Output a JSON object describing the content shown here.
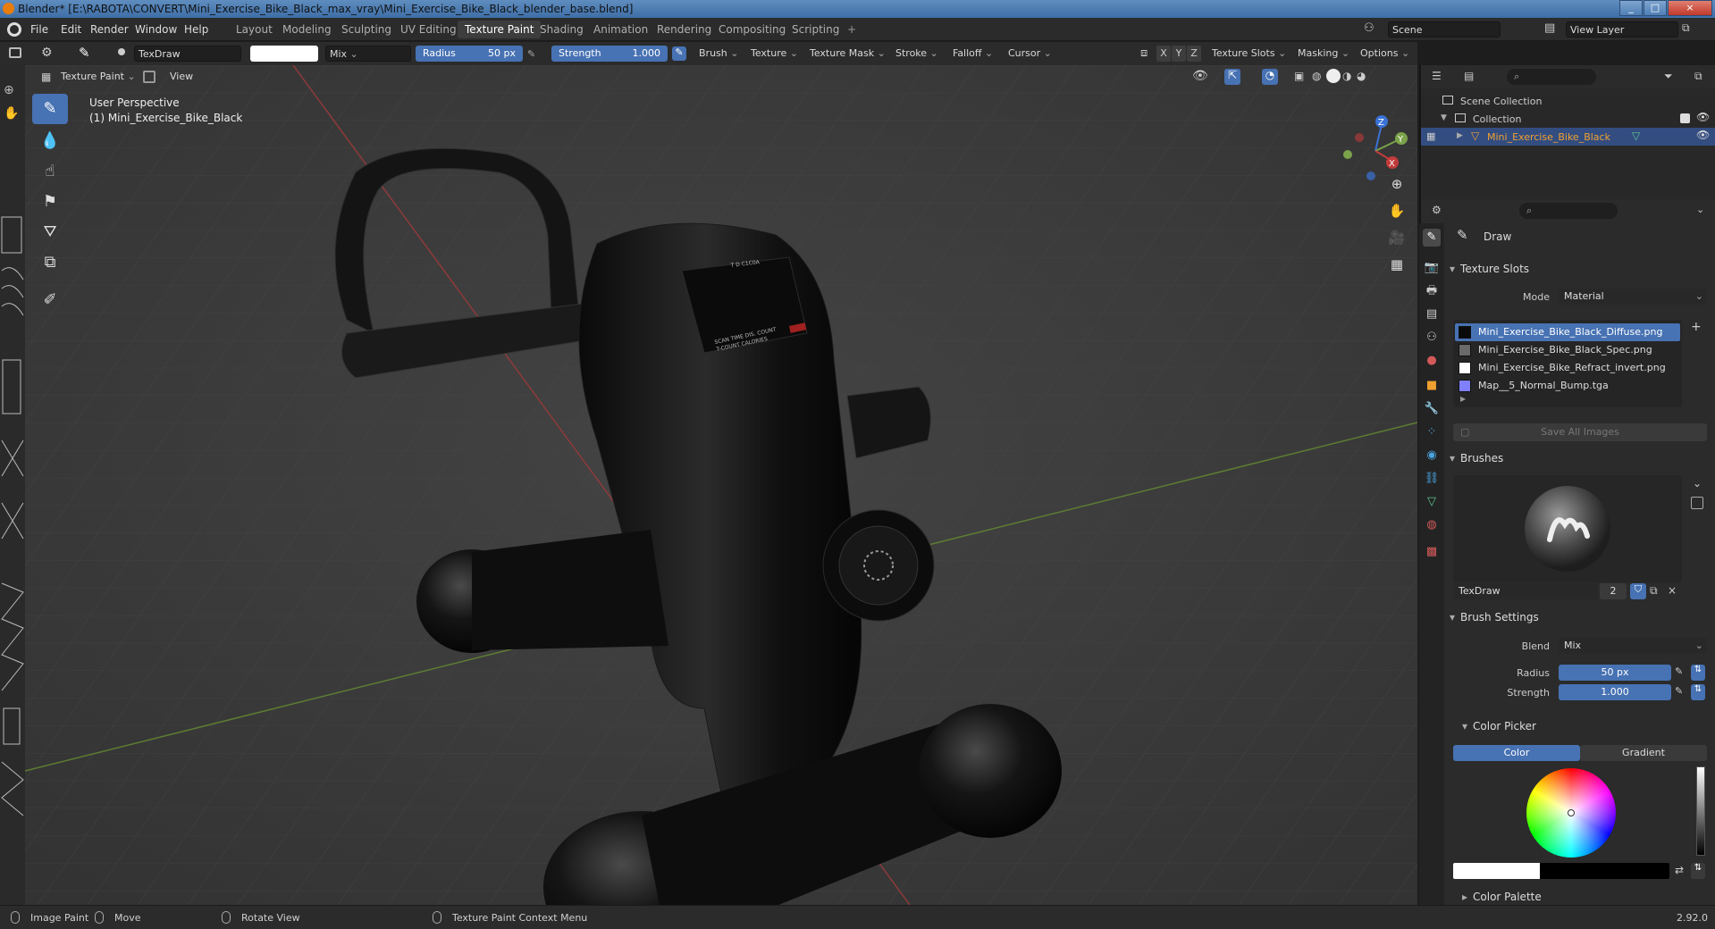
{
  "window": {
    "title": "Blender* [E:\\RABOTA\\CONVERT\\Mini_Exercise_Bike_Black_max_vray\\Mini_Exercise_Bike_Black_blender_base.blend]",
    "minimize": "_",
    "maximize": "□",
    "close": "×"
  },
  "menu": [
    "File",
    "Edit",
    "Render",
    "Window",
    "Help"
  ],
  "workspaces": [
    {
      "label": "Layout",
      "active": false
    },
    {
      "label": "Modeling",
      "active": false
    },
    {
      "label": "Sculpting",
      "active": false
    },
    {
      "label": "UV Editing",
      "active": false
    },
    {
      "label": "Texture Paint",
      "active": true
    },
    {
      "label": "Shading",
      "active": false
    },
    {
      "label": "Animation",
      "active": false
    },
    {
      "label": "Rendering",
      "active": false
    },
    {
      "label": "Compositing",
      "active": false
    },
    {
      "label": "Scripting",
      "active": false
    }
  ],
  "add_workspace": "+",
  "scene": {
    "label": "Scene",
    "view_layer": "View Layer"
  },
  "tool_header": {
    "brush_name": "TexDraw",
    "blend": "Mix",
    "radius_label": "Radius",
    "radius_value": "50 px",
    "strength_label": "Strength",
    "strength_value": "1.000",
    "menus": [
      "Brush",
      "Texture",
      "Texture Mask",
      "Stroke",
      "Falloff",
      "Cursor"
    ],
    "axes": [
      "X",
      "Y",
      "Z"
    ],
    "right_menus": [
      "Texture Slots",
      "Masking",
      "Options"
    ]
  },
  "view_header": {
    "mode": "Texture Paint",
    "view": "View"
  },
  "viewport": {
    "perspective": "User Perspective",
    "object": "(1) Mini_Exercise_Bike_Black",
    "gizmo": {
      "x": "X",
      "y": "Y",
      "z": "Z"
    },
    "panel_labels": [
      "T D C1C0A",
      "SCAN TIME DIS. COUNT",
      "T-COUNT CALORIES"
    ]
  },
  "outliner": {
    "scene_collection": "Scene Collection",
    "collection": "Collection",
    "object": "Mini_Exercise_Bike_Black"
  },
  "properties": {
    "tool_name": "Draw",
    "texture_slots": {
      "header": "Texture Slots",
      "mode_label": "Mode",
      "mode_value": "Material",
      "slots": [
        {
          "name": "Mini_Exercise_Bike_Black_Diffuse.png",
          "color": "#0a0a0a",
          "selected": true
        },
        {
          "name": "Mini_Exercise_Bike_Black_Spec.png",
          "color": "#6a6a6a",
          "selected": false
        },
        {
          "name": "Mini_Exercise_Bike_Refract_invert.png",
          "color": "#ffffff",
          "selected": false
        },
        {
          "name": "Map__5_Normal_Bump.tga",
          "color": "#8080ff",
          "selected": false
        }
      ],
      "save_all": "Save All Images"
    },
    "brushes": {
      "header": "Brushes",
      "brush_name": "TexDraw",
      "users": "2"
    },
    "brush_settings": {
      "header": "Brush Settings",
      "blend_label": "Blend",
      "blend_value": "Mix",
      "radius_label": "Radius",
      "radius_value": "50 px",
      "strength_label": "Strength",
      "strength_value": "1.000"
    },
    "color_picker": {
      "header": "Color Picker",
      "tab_color": "Color",
      "tab_gradient": "Gradient"
    },
    "color_palette": {
      "header": "Color Palette"
    }
  },
  "statusbar": {
    "left": "Image Paint",
    "move": "Move",
    "rotate": "Rotate View",
    "context": "Texture Paint Context Menu",
    "version": "2.92.0"
  },
  "colors": {
    "accent": "#4772b3",
    "orange": "#f0a030",
    "x_axis": "#c23b3b",
    "y_axis": "#7ba34a",
    "z_axis": "#3a72d6"
  }
}
